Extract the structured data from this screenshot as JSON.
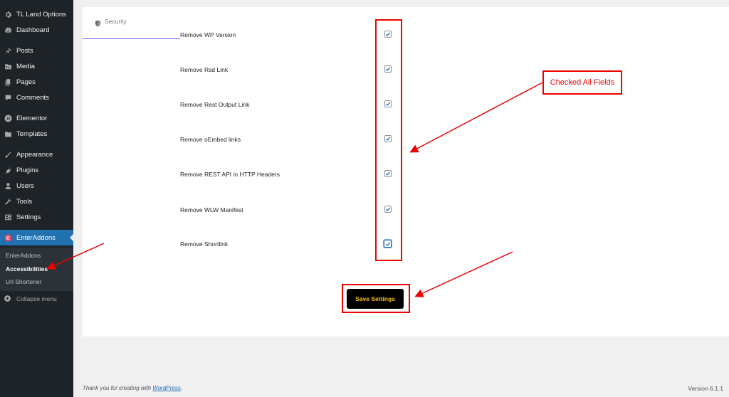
{
  "sidebar": {
    "items": [
      {
        "label": "TL Land Options",
        "icon": "gear-icon"
      },
      {
        "label": "Dashboard",
        "icon": "dashboard-icon"
      },
      {
        "label": "Posts",
        "icon": "pin-icon"
      },
      {
        "label": "Media",
        "icon": "media-icon"
      },
      {
        "label": "Pages",
        "icon": "pages-icon"
      },
      {
        "label": "Comments",
        "icon": "comment-icon"
      },
      {
        "label": "Elementor",
        "icon": "elementor-icon"
      },
      {
        "label": "Templates",
        "icon": "folder-icon"
      },
      {
        "label": "Appearance",
        "icon": "brush-icon"
      },
      {
        "label": "Plugins",
        "icon": "plug-icon"
      },
      {
        "label": "Users",
        "icon": "user-icon"
      },
      {
        "label": "Tools",
        "icon": "wrench-icon"
      },
      {
        "label": "Settings",
        "icon": "settings-icon"
      },
      {
        "label": "EnterAddons",
        "icon": "enteraddons-icon"
      }
    ],
    "submenu": [
      {
        "label": "EnterAddons"
      },
      {
        "label": "Accessibilities"
      },
      {
        "label": "Url Shortener"
      }
    ],
    "collapse_label": "Collapse menu"
  },
  "tabs": {
    "security_label": "Security"
  },
  "settings": {
    "rows": [
      {
        "label": "Remove WP Version",
        "checked": true
      },
      {
        "label": "Remove Rsd Link",
        "checked": true
      },
      {
        "label": "Remove Rest Output Link",
        "checked": true
      },
      {
        "label": "Remove oEmbed links",
        "checked": true
      },
      {
        "label": "Remove REST API in HTTP Headers",
        "checked": true
      },
      {
        "label": "Remove WLW Manifest",
        "checked": true
      },
      {
        "label": "Remove Shortlink",
        "checked": true
      }
    ],
    "save_label": "Save Settings"
  },
  "annotation": {
    "callout": "Checked All Fields"
  },
  "footer": {
    "thanks_prefix": "Thank you for creating with ",
    "thanks_link": "WordPress",
    "thanks_suffix": ".",
    "version": "Version 6.1.1"
  },
  "colors": {
    "sidebar_bg": "#1d2327",
    "active_bg": "#2271b1",
    "accent_purple": "#7a5af8",
    "save_text": "#f6c21c",
    "annotation_red": "#e00000"
  }
}
